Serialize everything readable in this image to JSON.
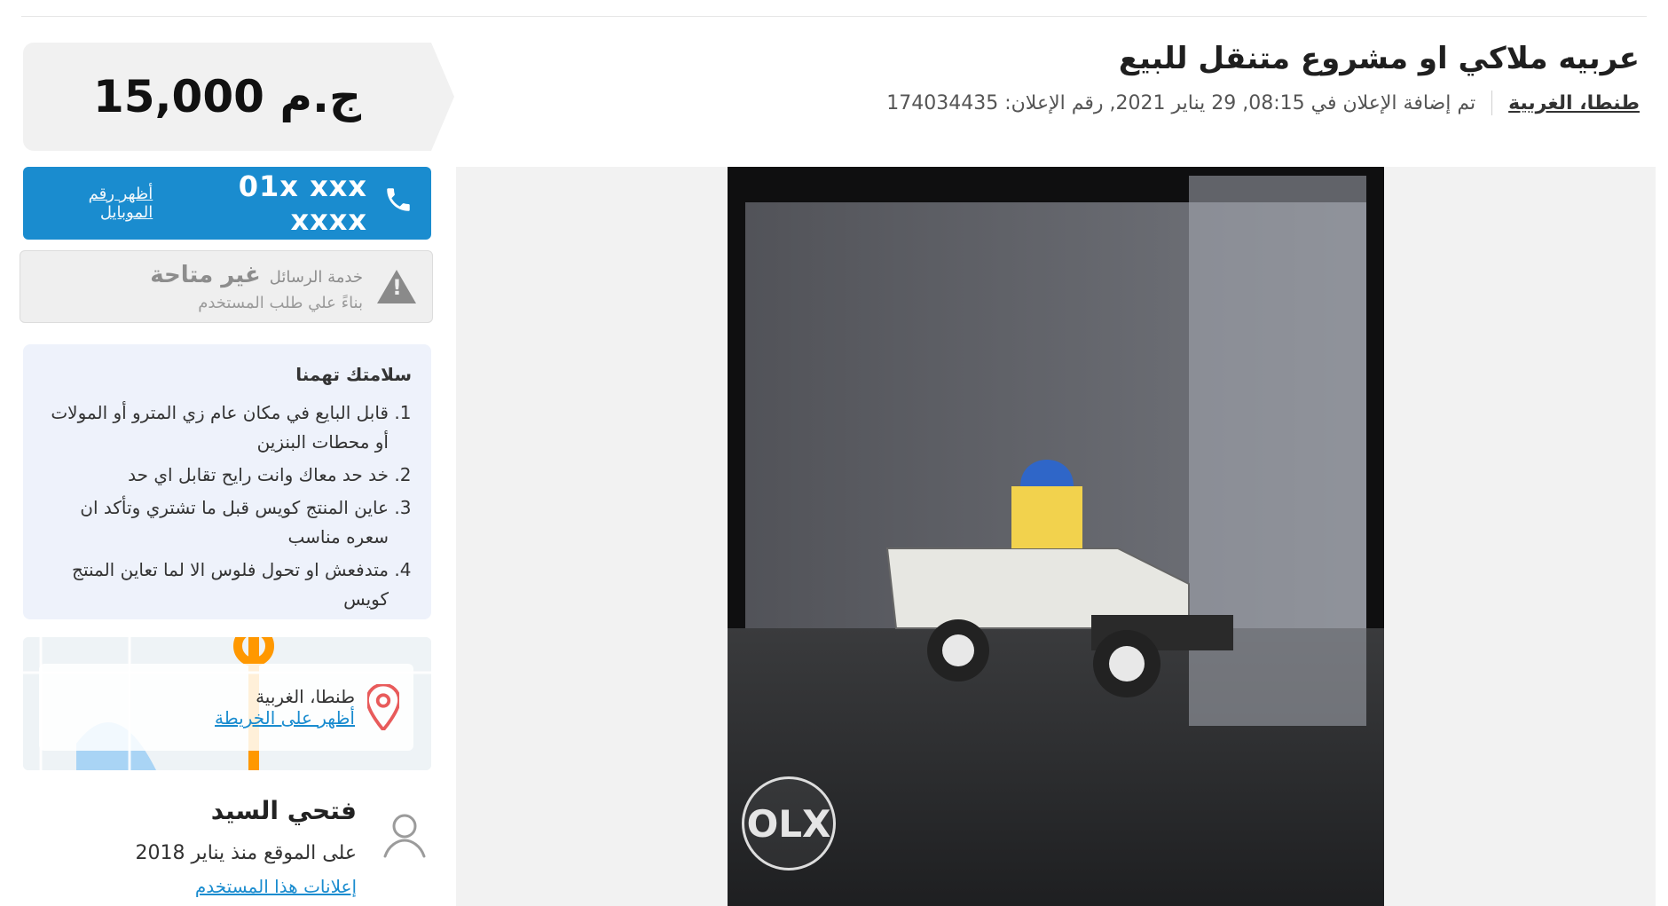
{
  "header": {
    "title": "عربيه ملاكي او مشروع متنقل للبيع",
    "location": "طنطا، الغربية",
    "posted": "تم إضافة الإعلان في 08:15, 29 يناير 2021, رقم الإعلان: 174034435"
  },
  "price": "15,000 ج.م",
  "phone": {
    "number": "01x xxx xxxx",
    "reveal_label": "أظهر رقم الموبايل"
  },
  "messaging": {
    "label": "خدمة الرسائل",
    "status": "غير متاحة",
    "reason": "بناءً علي طلب المستخدم"
  },
  "safety": {
    "title": "سلامتك تهمنا",
    "tips": [
      "قابل البايع في مكان عام زي المترو أو المولات أو محطات البنزين",
      "خد حد معاك وانت رايح تقابل اي حد",
      "عاين المنتج كويس قبل ما تشتري وتأكد ان سعره مناسب",
      "متدفعش او تحول فلوس الا لما تعاين المنتج كويس"
    ]
  },
  "map": {
    "location": "طنطا، الغربية",
    "link": "أظهر على الخريطة"
  },
  "seller": {
    "name": "فتحي السيد",
    "since": "على الموقع منذ يناير 2018",
    "ads_link": "إعلانات هذا المستخدم"
  },
  "photo": {
    "watermark": "OLX"
  },
  "icons": {
    "phone": "phone-icon",
    "warning": "warning-icon",
    "pin": "map-pin-icon",
    "user": "user-icon"
  },
  "colors": {
    "accent": "#1a8ccf",
    "price_bg": "#f1f1f1",
    "safety_bg": "#eef2fb"
  }
}
